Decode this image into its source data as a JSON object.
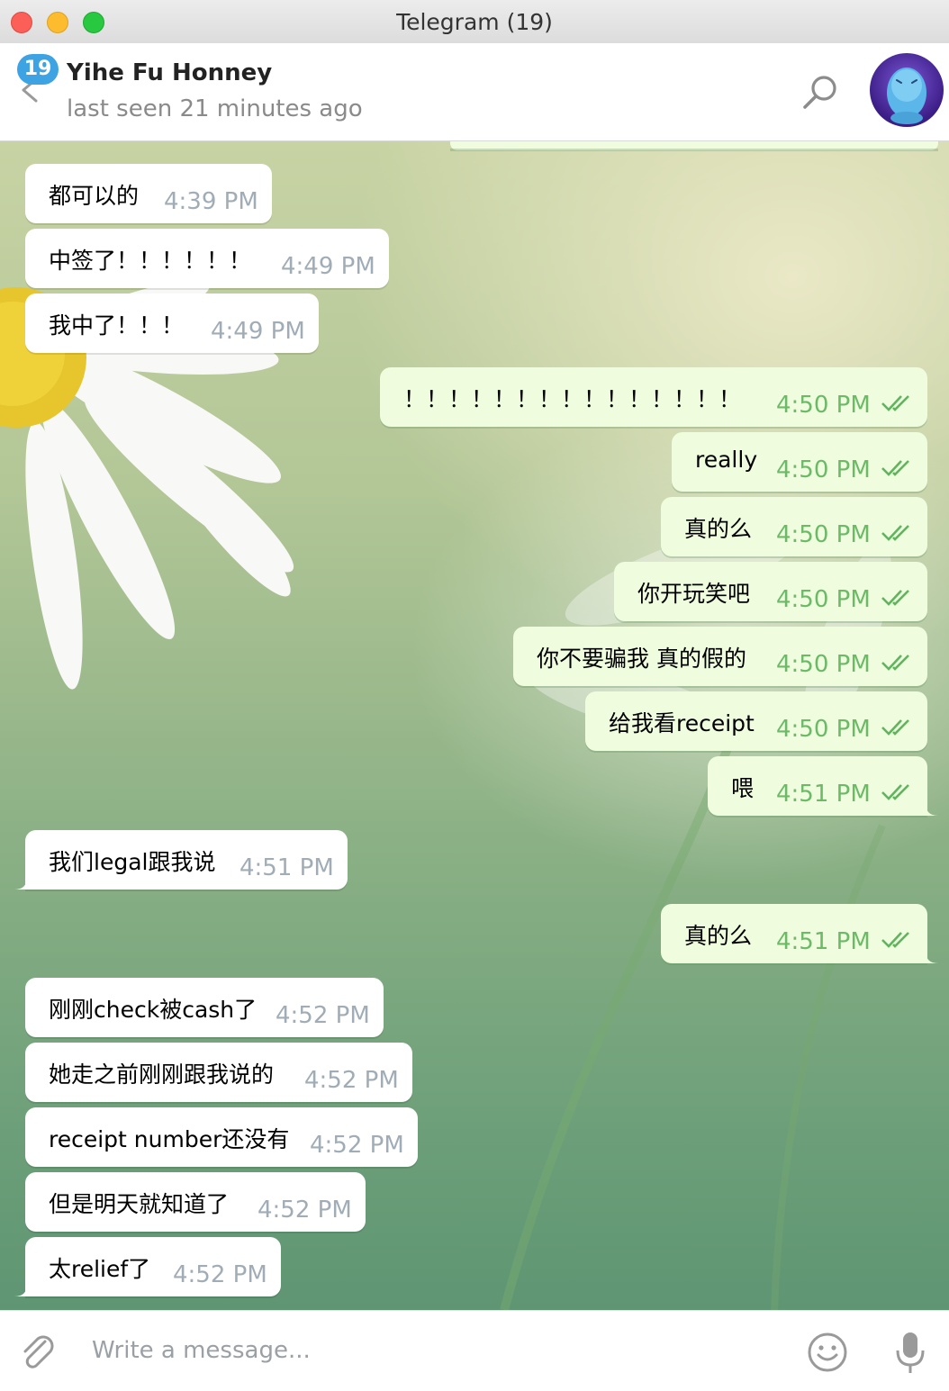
{
  "window": {
    "title": "Telegram (19)"
  },
  "header": {
    "unread_badge": "19",
    "peer_name": "Yihe Fu Honney",
    "peer_status": "last seen 21 minutes ago"
  },
  "messages": [
    {
      "dir": "in",
      "text": "都可以的",
      "time": "4:39 PM"
    },
    {
      "dir": "in",
      "text": "中签了！！！！！！",
      "time": "4:49 PM"
    },
    {
      "dir": "in",
      "text": "我中了！！！",
      "time": "4:49 PM"
    },
    {
      "dir": "out",
      "text": "！！！！！！！！！！！！！！！",
      "time": "4:50 PM",
      "read": true
    },
    {
      "dir": "out",
      "text": "really",
      "time": "4:50 PM",
      "read": true
    },
    {
      "dir": "out",
      "text": "真的么",
      "time": "4:50 PM",
      "read": true
    },
    {
      "dir": "out",
      "text": "你开玩笑吧",
      "time": "4:50 PM",
      "read": true
    },
    {
      "dir": "out",
      "text": "你不要骗我 真的假的",
      "time": "4:50 PM",
      "read": true
    },
    {
      "dir": "out",
      "text": "给我看receipt",
      "time": "4:50 PM",
      "read": true
    },
    {
      "dir": "out",
      "text": "喂",
      "time": "4:51 PM",
      "read": true
    },
    {
      "dir": "in",
      "text": "我们legal跟我说",
      "time": "4:51 PM"
    },
    {
      "dir": "out",
      "text": "真的么",
      "time": "4:51 PM",
      "read": true
    },
    {
      "dir": "in",
      "text": "刚刚check被cash了",
      "time": "4:52 PM"
    },
    {
      "dir": "in",
      "text": "她走之前刚刚跟我说的",
      "time": "4:52 PM"
    },
    {
      "dir": "in",
      "text": "receipt number还没有",
      "time": "4:52 PM"
    },
    {
      "dir": "in",
      "text": "但是明天就知道了",
      "time": "4:52 PM"
    },
    {
      "dir": "in",
      "text": "太relief了",
      "time": "4:52 PM"
    }
  ],
  "composer": {
    "placeholder": "Write a message..."
  },
  "colors": {
    "accent": "#3ea3e3",
    "out_bubble": "#effdde",
    "out_meta": "#6cb968",
    "in_meta": "#a0acb6"
  },
  "icons": [
    "back-arrow-icon",
    "search-icon",
    "attach-icon",
    "emoji-icon",
    "microphone-icon",
    "double-check-icon"
  ]
}
